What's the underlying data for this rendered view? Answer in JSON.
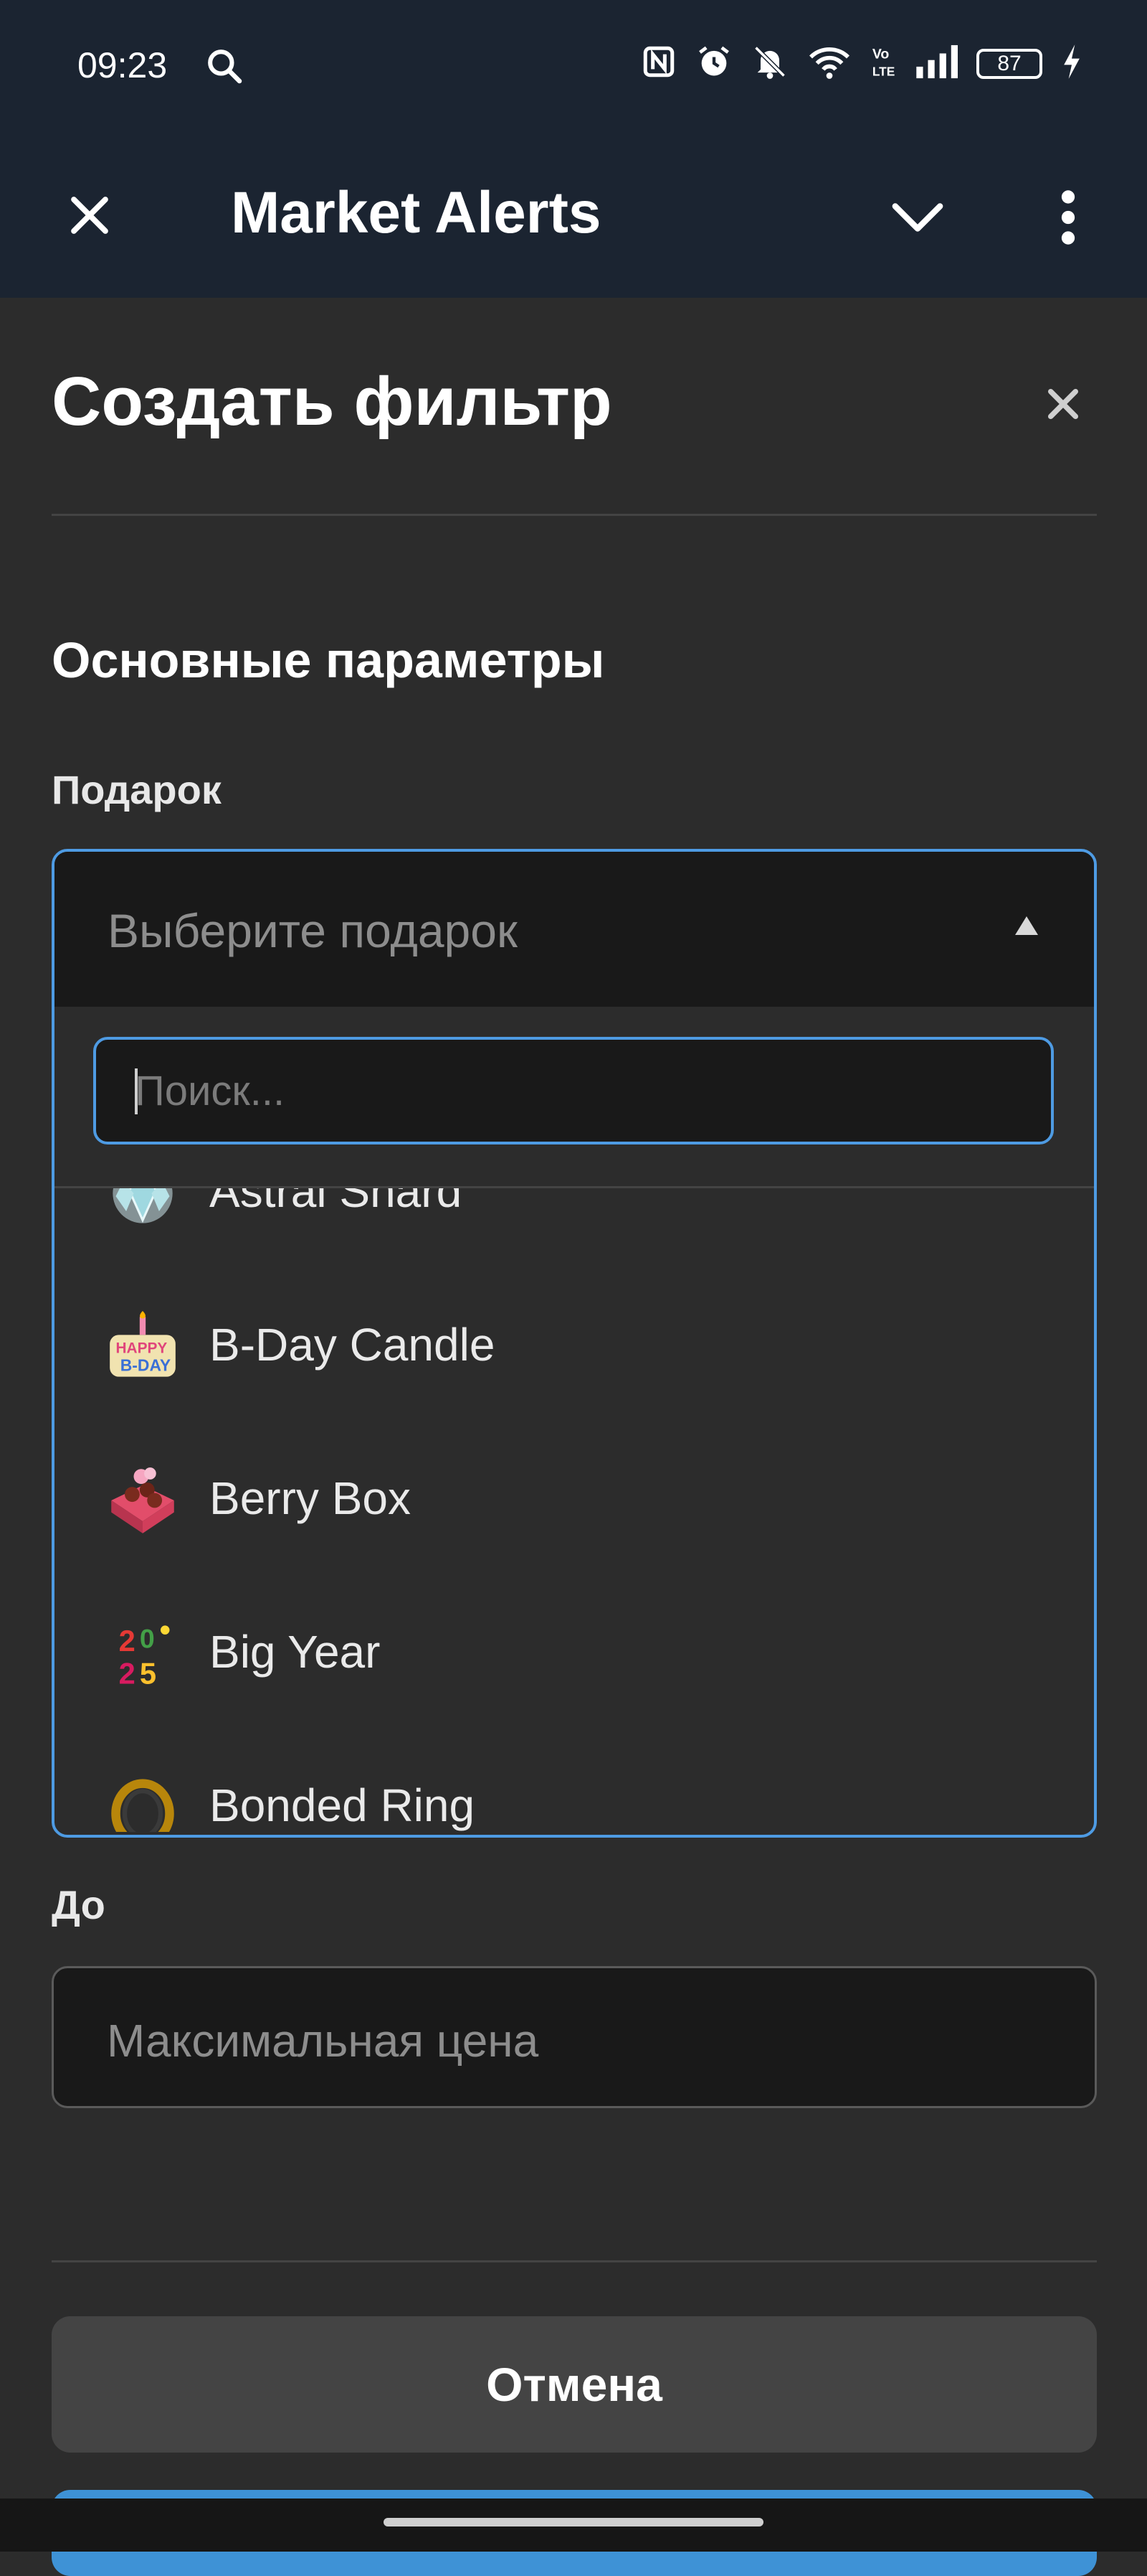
{
  "status_bar": {
    "time": "09:23",
    "battery": "87"
  },
  "app_bar": {
    "title": "Market Alerts"
  },
  "dialog": {
    "title": "Создать фильтр",
    "section_title": "Основные параметры",
    "gift_label": "Подарок",
    "gift_select": {
      "placeholder": "Выберите подарок",
      "search_placeholder": "Поиск...",
      "options": [
        {
          "label": "Astral Shard",
          "icon": "crystal-icon"
        },
        {
          "label": "B-Day Candle",
          "icon": "birthday-candle-icon"
        },
        {
          "label": "Berry Box",
          "icon": "berry-box-icon"
        },
        {
          "label": "Big Year",
          "icon": "big-year-icon"
        },
        {
          "label": "Bonded Ring",
          "icon": "ring-icon"
        }
      ]
    },
    "to_label": "До",
    "to_placeholder": "Максимальная цена",
    "cancel_label": "Отмена"
  }
}
